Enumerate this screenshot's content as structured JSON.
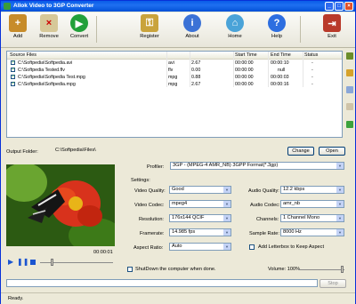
{
  "window": {
    "title": "Allok Video to 3GP Converter"
  },
  "toolbar": {
    "add": "Add",
    "remove": "Remove",
    "convert": "Convert",
    "register": "Register",
    "about": "About",
    "home": "Home",
    "help": "Help",
    "exit": "Exit"
  },
  "files": {
    "headers": {
      "source": "Source Files",
      "start": "Start Time",
      "end": "End Time",
      "status": "Status"
    },
    "rows": [
      {
        "path": "C:\\Softpedia\\Softpedia.avi",
        "ext": "avi",
        "dur": "2.67",
        "start": "00:00:00",
        "end": "00:00:10",
        "status": "-"
      },
      {
        "path": "C:\\Softpedia Tested.flv",
        "ext": "flv",
        "dur": "0.00",
        "start": "00:00:00",
        "end": "null",
        "status": "-"
      },
      {
        "path": "C:\\Softpedia\\Softpedia Test.mpg",
        "ext": "mpg",
        "dur": "0.88",
        "start": "00:00:00",
        "end": "00:00:03",
        "status": "-"
      },
      {
        "path": "C:\\Softpedia\\Softpedia.mpg",
        "ext": "mpg",
        "dur": "2.67",
        "start": "00:00:00",
        "end": "00:00:16",
        "status": "-"
      }
    ]
  },
  "output": {
    "label": "Output Folder:",
    "path": "C:\\Softpedia\\Files\\",
    "change": "Change",
    "open": "Open"
  },
  "profile": {
    "label": "Profiler:",
    "value": "3GP - (MPEG-4 AMR_NB) 3GPP Format(*.3gp)"
  },
  "settings": {
    "label": "Settings:",
    "video_quality": {
      "label": "Video Quality:",
      "value": "Good"
    },
    "video_codec": {
      "label": "Video Codec:",
      "value": "mpeg4"
    },
    "resolution": {
      "label": "Resolution:",
      "value": "176x144 QCIF"
    },
    "framerate": {
      "label": "Framerate:",
      "value": "14.985 fps"
    },
    "aspect": {
      "label": "Aspect Ratio:",
      "value": "Auto"
    },
    "audio_quality": {
      "label": "Audio Quality:",
      "value": "12.2  kbps"
    },
    "audio_codec": {
      "label": "Audio Codec:",
      "value": "amr_nb"
    },
    "channels": {
      "label": "Channels:",
      "value": "1 Channel Mono"
    },
    "sample_rate": {
      "label": "Sample Rate:",
      "value": "8000 Hz"
    },
    "letterbox": "Add Letterbox to Keep Aspect"
  },
  "player": {
    "time": "00:00:01"
  },
  "shutdown": "ShutDown the computer when done.",
  "volume": "Volume: 100%",
  "stop": "Stop",
  "status": "Ready."
}
